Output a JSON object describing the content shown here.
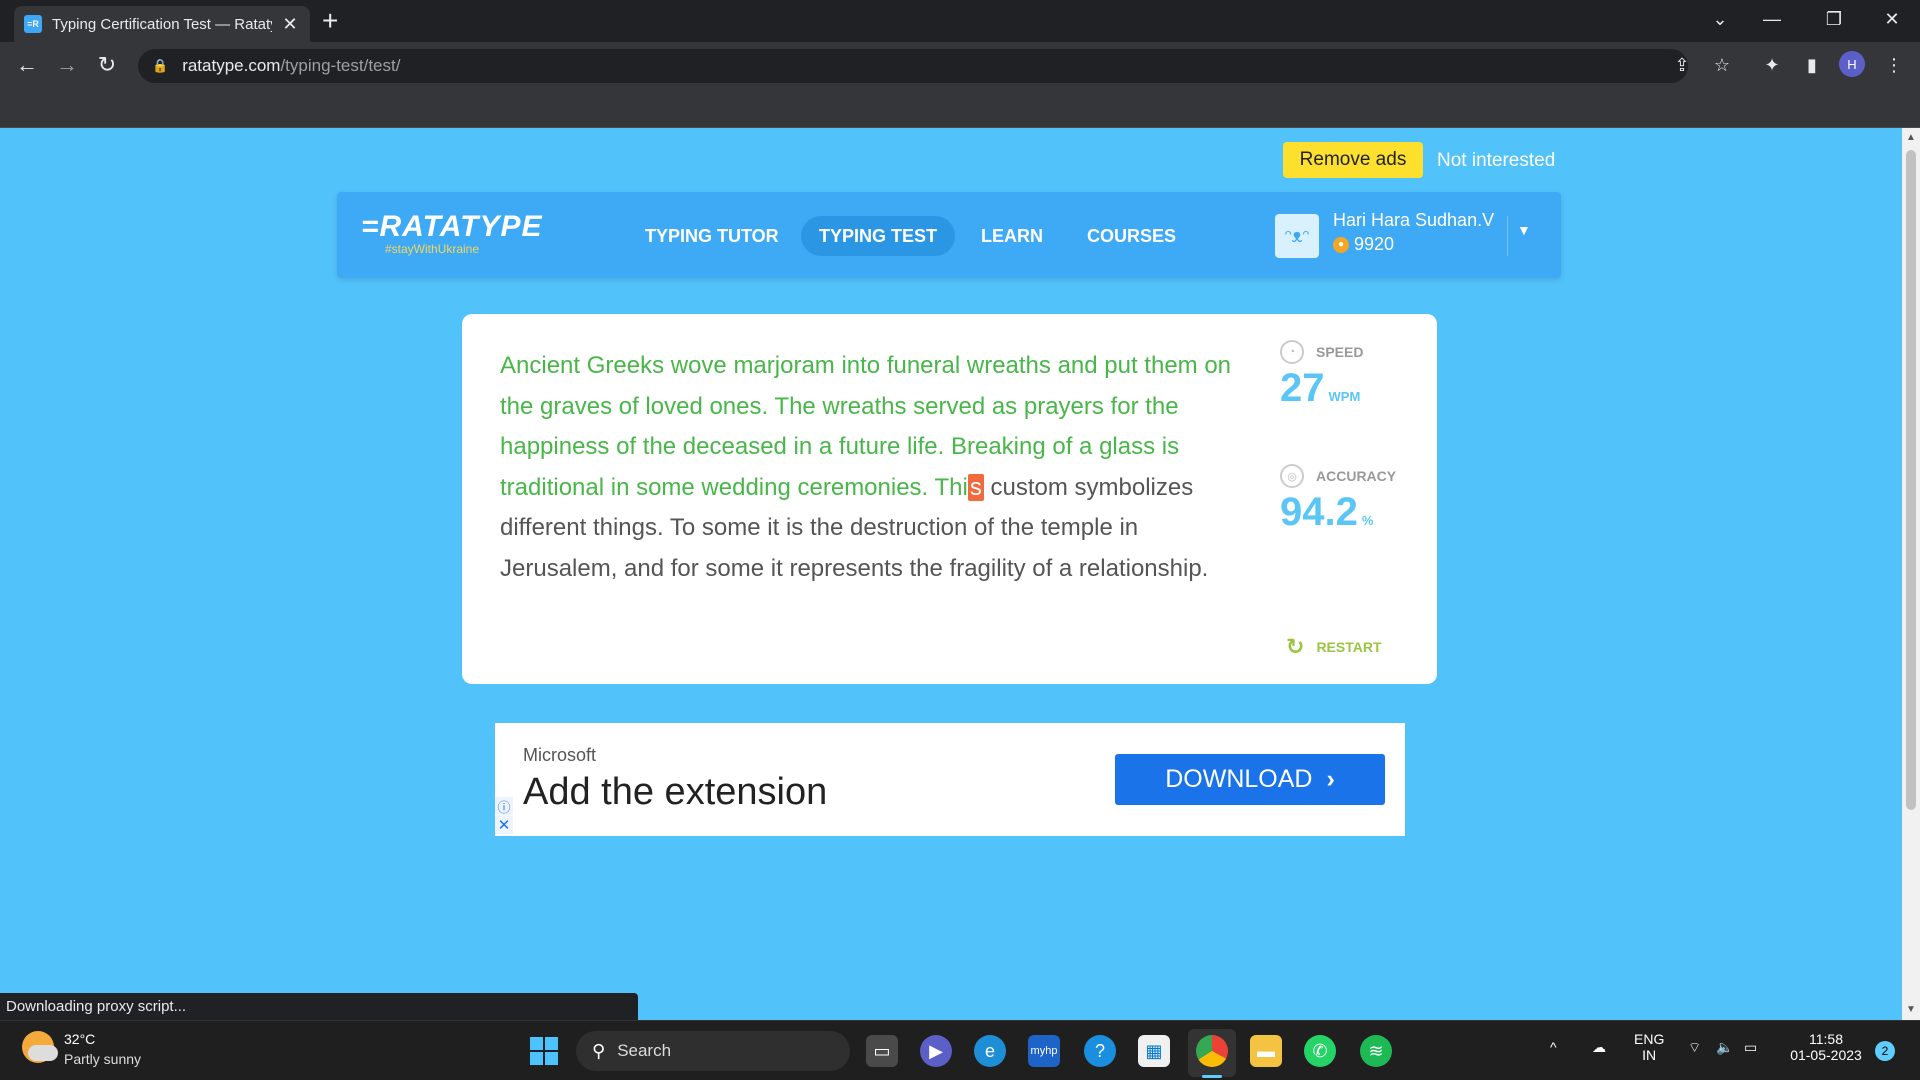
{
  "browser": {
    "tab_title": "Typing Certification Test — Ratatype",
    "tab_favicon": "=R",
    "url_host": "ratatype.com",
    "url_path": "/typing-test/test/",
    "profile_initial": "H"
  },
  "top_ads": {
    "remove_ads": "Remove ads",
    "not_interested": "Not interested"
  },
  "site": {
    "logo": "=RATATYPE",
    "logo_sub": "#stayWithUkraine",
    "nav": [
      {
        "label": "TYPING TUTOR",
        "active": false
      },
      {
        "label": "TYPING TEST",
        "active": true
      },
      {
        "label": "LEARN",
        "active": false
      },
      {
        "label": "COURSES",
        "active": false
      }
    ],
    "user": {
      "name": "Hari Hara Sudhan.V",
      "coins": "9920"
    }
  },
  "test": {
    "typed_text": "Ancient Greeks wove marjoram into funeral wreaths and put them on the graves of loved ones. The wreaths served as prayers for the happiness of the deceased in a future life. Breaking of a glass is traditional in some wedding ceremonies. Thi",
    "current_char": "s",
    "remaining_text": " custom symbolizes different things. To some it is the destruction of the temple in Jerusalem, and for some it represents the fragility of a relationship.",
    "speed_label": "SPEED",
    "speed_value": "27",
    "speed_unit": "WPM",
    "accuracy_label": "ACCURACY",
    "accuracy_value": "94.2",
    "accuracy_unit": "%",
    "restart_label": "RESTART"
  },
  "ad": {
    "brand": "Microsoft",
    "headline": "Add the extension",
    "button": "DOWNLOAD"
  },
  "status": "Downloading proxy script...",
  "taskbar": {
    "temp": "32°C",
    "condition": "Partly sunny",
    "search": "Search",
    "lang_top": "ENG",
    "lang_bottom": "IN",
    "time": "11:58",
    "date": "01-05-2023",
    "notifications": "2"
  },
  "colors": {
    "page_bg": "#52c2fa",
    "nav_bg": "#3eaaf6",
    "typed_green": "#49b649",
    "cursor_orange": "#f06a3e",
    "stat_blue": "#5bc6f5",
    "restart_green": "#9ac53f",
    "remove_ads_yellow": "#fde02d"
  }
}
